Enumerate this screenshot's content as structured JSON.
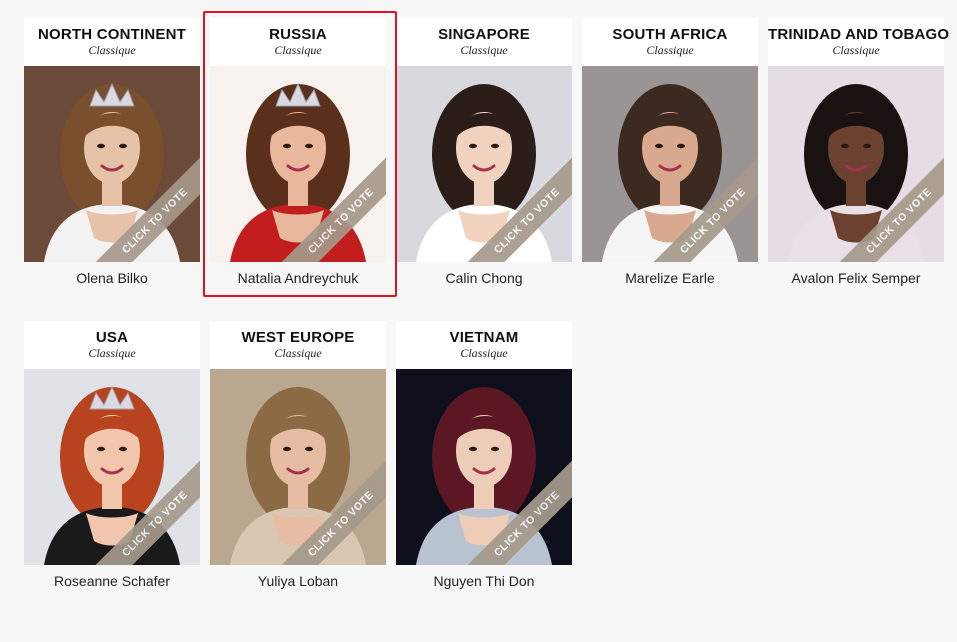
{
  "category_label": "Classique",
  "vote_label": "CLICK TO VOTE",
  "contestants": [
    {
      "country": "NORTH CONTINENT",
      "name": "Olena Bilko",
      "bg": "#6b4a3a",
      "hair": "#7a4f2e",
      "skin": "#e8c2a6",
      "dress": "#f2f2f2"
    },
    {
      "country": "RUSSIA",
      "name": "Natalia Andreychuk",
      "bg": "#f7f2ee",
      "hair": "#5a2f1c",
      "skin": "#e9b79c",
      "dress": "#c31e1e"
    },
    {
      "country": "SINGAPORE",
      "name": "Calin Chong",
      "bg": "#d8d9de",
      "hair": "#2b1d17",
      "skin": "#f0d2bf",
      "dress": "#ffffff"
    },
    {
      "country": "SOUTH AFRICA",
      "name": "Marelize Earle",
      "bg": "#9a9494",
      "hair": "#3c2a20",
      "skin": "#d8a98f",
      "dress": "#f5f5f5"
    },
    {
      "country": "TRINIDAD AND TOBAGO",
      "name": "Avalon Felix Semper",
      "bg": "#e6dde4",
      "hair": "#1a1210",
      "skin": "#6b4130",
      "dress": "#e8e0e6"
    },
    {
      "country": "USA",
      "name": "Roseanne Schafer",
      "bg": "#dfe3e8",
      "hair": "#b8431f",
      "skin": "#f1c6ad",
      "dress": "#1a1a1a"
    },
    {
      "country": "WEST EUROPE",
      "name": "Yuliya Loban",
      "bg": "#b9a88f",
      "hair": "#8c6a45",
      "skin": "#e6bca2",
      "dress": "#d9c7b3"
    },
    {
      "country": "VIETNAM",
      "name": "Nguyen Thi Don",
      "bg": "#0d0f1a",
      "hair": "#5b1724",
      "skin": "#edcdb8",
      "dress": "#b9c3cf"
    }
  ],
  "selected_index": 1
}
